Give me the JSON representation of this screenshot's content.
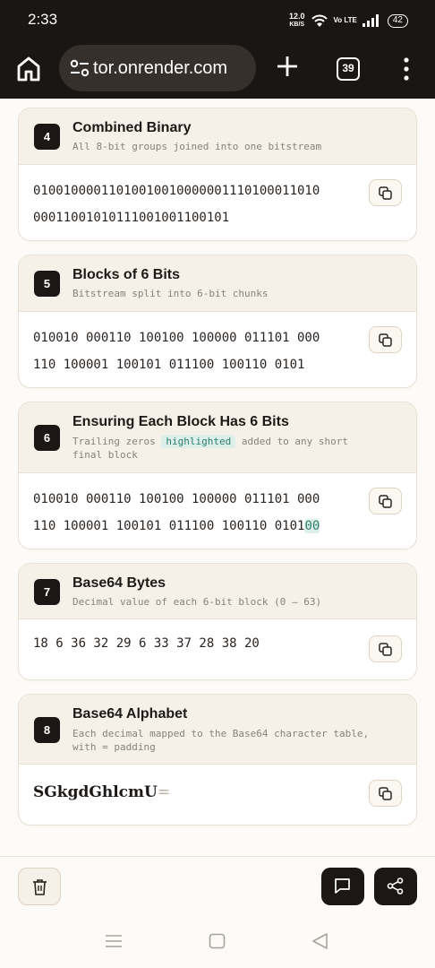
{
  "status": {
    "time": "2:33",
    "speed_value": "12.0",
    "speed_unit": "KB/S",
    "volte": "Vo LTE",
    "battery": "42"
  },
  "browser": {
    "url": "tor.onrender.com",
    "tab_count": "39"
  },
  "cards": [
    {
      "number": "4",
      "title": "Combined Binary",
      "subtitle": "All 8-bit groups joined into one bitstream",
      "lines": [
        "010010000110100100100000011101000110 10",
        "000110010101110010011001 01"
      ]
    },
    {
      "number": "5",
      "title": "Blocks of 6 Bits",
      "subtitle": "Bitstream split into 6-bit chunks",
      "lines": [
        "010010 000110 100100 100000 011101 000",
        "110 100001 100101 011100 100110 0101"
      ]
    },
    {
      "number": "6",
      "title": "Ensuring Each Block Has 6 Bits",
      "subtitle_before": "Trailing zeros",
      "subtitle_highlight": "highlighted",
      "subtitle_after": "added to any short",
      "subtitle_line2": "final block",
      "line1": "010010 000110 100100 100000 011101 000",
      "line2": "110 100001 100101 011100 100110 0101",
      "padding": "00"
    },
    {
      "number": "7",
      "title": "Base64 Bytes",
      "subtitle": "Decimal value of each 6-bit block (0 – 63)",
      "value": "18 6 36 32 29 6 33 37 28 38 20"
    },
    {
      "number": "8",
      "title": "Base64 Alphabet",
      "subtitle_line1": "Each decimal mapped to the Base64 character table,",
      "subtitle_line2": "with = padding",
      "encoded": "SGkgdGhlcmU",
      "padding": "="
    }
  ],
  "card4_line1": "010010000110100100100000011101000110​10",
  "card4_line2": "00011001010111001001100101",
  "colors": {
    "dark": "#1c1714",
    "card_header": "#f6f1e8",
    "highlight_bg": "#dcefe9",
    "highlight_text": "#2f7d6b"
  },
  "icons": {
    "home": "home-icon",
    "tune": "tune-icon",
    "plus": "plus-icon",
    "menu": "kebab-menu-icon",
    "copy": "copy-icon",
    "trash": "trash-icon",
    "chat": "chat-icon",
    "share": "share-icon"
  }
}
